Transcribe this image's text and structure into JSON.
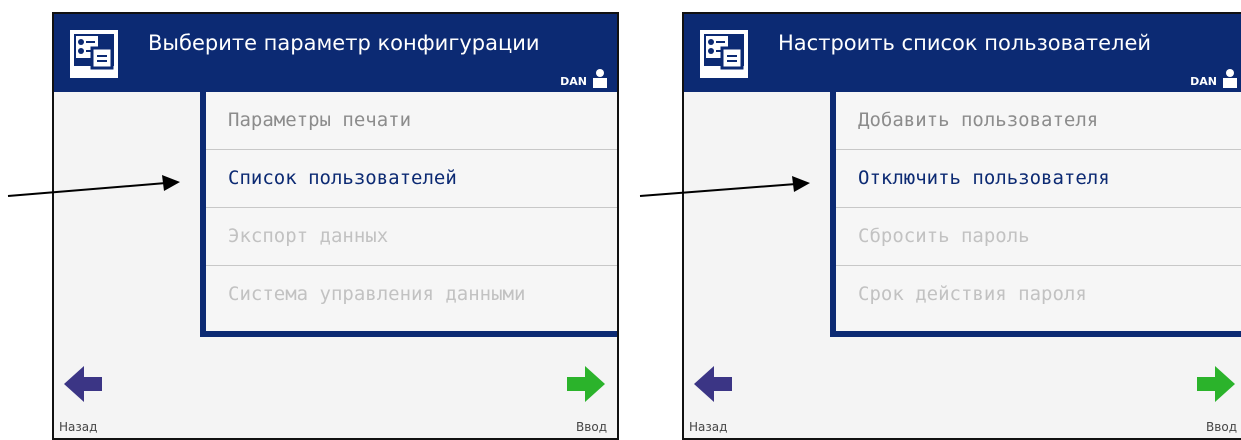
{
  "screens": [
    {
      "title": "Выберите параметр конфигурации",
      "user": "DAN",
      "menu": [
        {
          "label": "Параметры печати",
          "state": "normal"
        },
        {
          "label": "Список пользователей",
          "state": "selected"
        },
        {
          "label": "Экспорт данных",
          "state": "disabled"
        },
        {
          "label": "Система управления данными",
          "state": "disabled"
        }
      ],
      "back_label": "Назад",
      "enter_label": "Ввод"
    },
    {
      "title": "Настроить список пользователей",
      "user": "DAN",
      "menu": [
        {
          "label": "Добавить пользователя",
          "state": "normal"
        },
        {
          "label": "Отключить пользователя",
          "state": "selected"
        },
        {
          "label": "Сбросить пароль",
          "state": "disabled"
        },
        {
          "label": "Срок действия пароля",
          "state": "disabled"
        }
      ],
      "back_label": "Назад",
      "enter_label": "Ввод"
    }
  ],
  "colors": {
    "header": "#0c2a73",
    "back_arrow": "#3b3585",
    "enter_arrow": "#2bb32b"
  },
  "icons": [
    "config-icon",
    "user-icon",
    "back-arrow-icon",
    "enter-arrow-icon",
    "pointer-arrow"
  ]
}
